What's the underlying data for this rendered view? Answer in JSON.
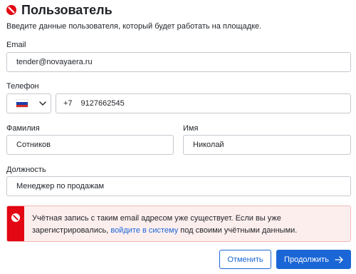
{
  "header": {
    "title": "Пользователь",
    "subtitle": "Введите данные пользователя, который будет работать на площадке."
  },
  "form": {
    "email": {
      "label": "Email",
      "value": "tender@novayaera.ru"
    },
    "phone": {
      "label": "Телефон",
      "country": "Россия",
      "code": "+7",
      "value": "9127662545"
    },
    "last_name": {
      "label": "Фамилия",
      "value": "Сотников"
    },
    "first_name": {
      "label": "Имя",
      "value": "Николай"
    },
    "position": {
      "label": "Должность",
      "value": "Менеджер по продажам"
    }
  },
  "alert": {
    "text_before": "Учётная запись с таким email адресом уже существует. Если вы уже зарегистрировались, ",
    "link": "войдите в систему",
    "text_after": " под своими учётными данными."
  },
  "buttons": {
    "cancel": "Отменить",
    "continue": "Продолжить"
  },
  "colors": {
    "accent": "#1a66d6",
    "error": "#e30613",
    "error_bg": "#fdeeee"
  },
  "icons": {
    "header": "prohibited-icon",
    "alert": "prohibited-icon",
    "dropdown": "chevron-down-icon",
    "continue": "arrow-right-icon"
  }
}
